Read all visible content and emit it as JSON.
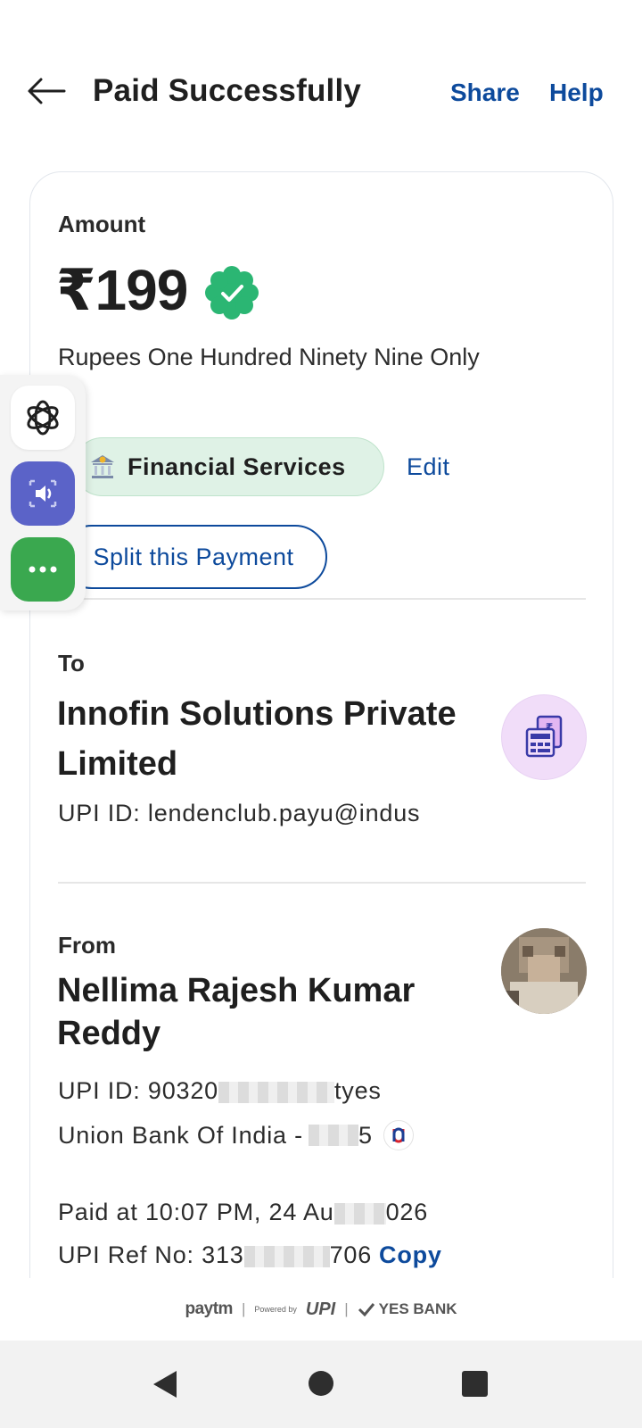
{
  "header": {
    "title": "Paid Successfully",
    "share_label": "Share",
    "help_label": "Help"
  },
  "amount": {
    "label": "Amount",
    "value": "₹199",
    "words": "Rupees One Hundred Ninety Nine Only",
    "category": "Financial Services",
    "edit_label": "Edit",
    "split_label": "Split this Payment"
  },
  "to": {
    "label": "To",
    "name": "Innofin Solutions Private Limited",
    "upi_id": "UPI ID: lendenclub.payu@indus"
  },
  "from": {
    "label": "From",
    "name": "Nellima Rajesh Kumar Reddy",
    "upi_prefix": "UPI ID: 90320",
    "upi_suffix": "tyes",
    "bank_prefix": "Union Bank Of India - ",
    "bank_suffix": "5"
  },
  "transaction": {
    "paid_at_prefix": "Paid at 10:07 PM, 24 Au",
    "paid_at_suffix": "026",
    "ref_prefix": "UPI Ref No: 313",
    "ref_suffix": "706",
    "copy_label": "Copy"
  },
  "footer": {
    "paytm": "paytm",
    "powered_by": "Powered by",
    "upi": "UPI",
    "bank": "YES BANK"
  },
  "colors": {
    "accent": "#0d4a9c",
    "success": "#2bb673",
    "chip_bg": "#dff2e6"
  }
}
